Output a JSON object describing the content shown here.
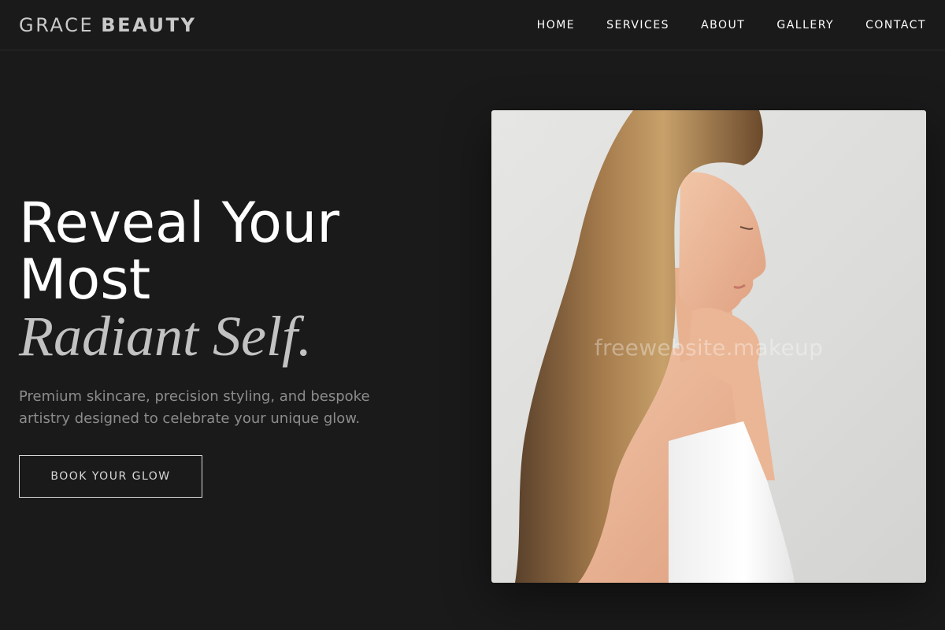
{
  "brand": {
    "light": "GRACE",
    "bold": "BEAUTY"
  },
  "nav": {
    "items": [
      {
        "label": "HOME"
      },
      {
        "label": "SERVICES"
      },
      {
        "label": "ABOUT"
      },
      {
        "label": "GALLERY"
      },
      {
        "label": "CONTACT"
      }
    ]
  },
  "hero": {
    "title_line1": "Reveal Your",
    "title_line2": "Most",
    "title_accent": "Radiant Self.",
    "subtitle": "Premium skincare, precision styling, and bespoke artistry designed to celebrate your unique glow.",
    "cta_label": "BOOK YOUR GLOW",
    "image_watermark": "freewebsite.makeup"
  },
  "colors": {
    "background": "#1a1a1a",
    "accent_text": "#c2c2c2",
    "muted_text": "#8c8c8c",
    "photo_background": "#e0e0de"
  }
}
